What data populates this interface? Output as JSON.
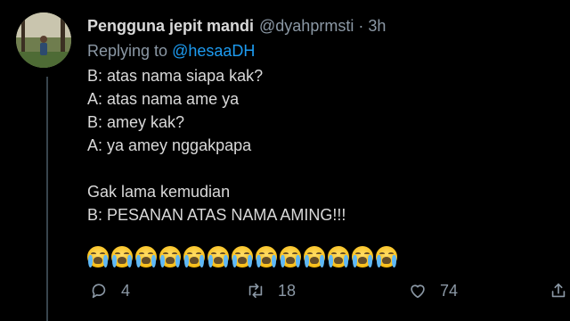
{
  "tweet": {
    "display_name": "Pengguna jepit mandi",
    "handle": "@dyahprmsti",
    "separator": "·",
    "time": "3h",
    "replying_prefix": "Replying to",
    "replying_handle": "@hesaaDH",
    "lines": [
      "B: atas nama siapa kak?",
      "A: atas nama ame ya",
      "B: amey kak?",
      "A: ya amey nggakpapa",
      "",
      "Gak lama kemudian",
      "B: PESANAN ATAS NAMA AMING!!!"
    ],
    "emoji_name": "loudly-crying-face",
    "emoji_count": 13,
    "actions": {
      "reply_count": "4",
      "retweet_count": "18",
      "like_count": "74"
    }
  },
  "colors": {
    "background": "#000000",
    "text": "#d9d9d9",
    "muted": "#8b98a5",
    "link": "#1d9bf0"
  }
}
